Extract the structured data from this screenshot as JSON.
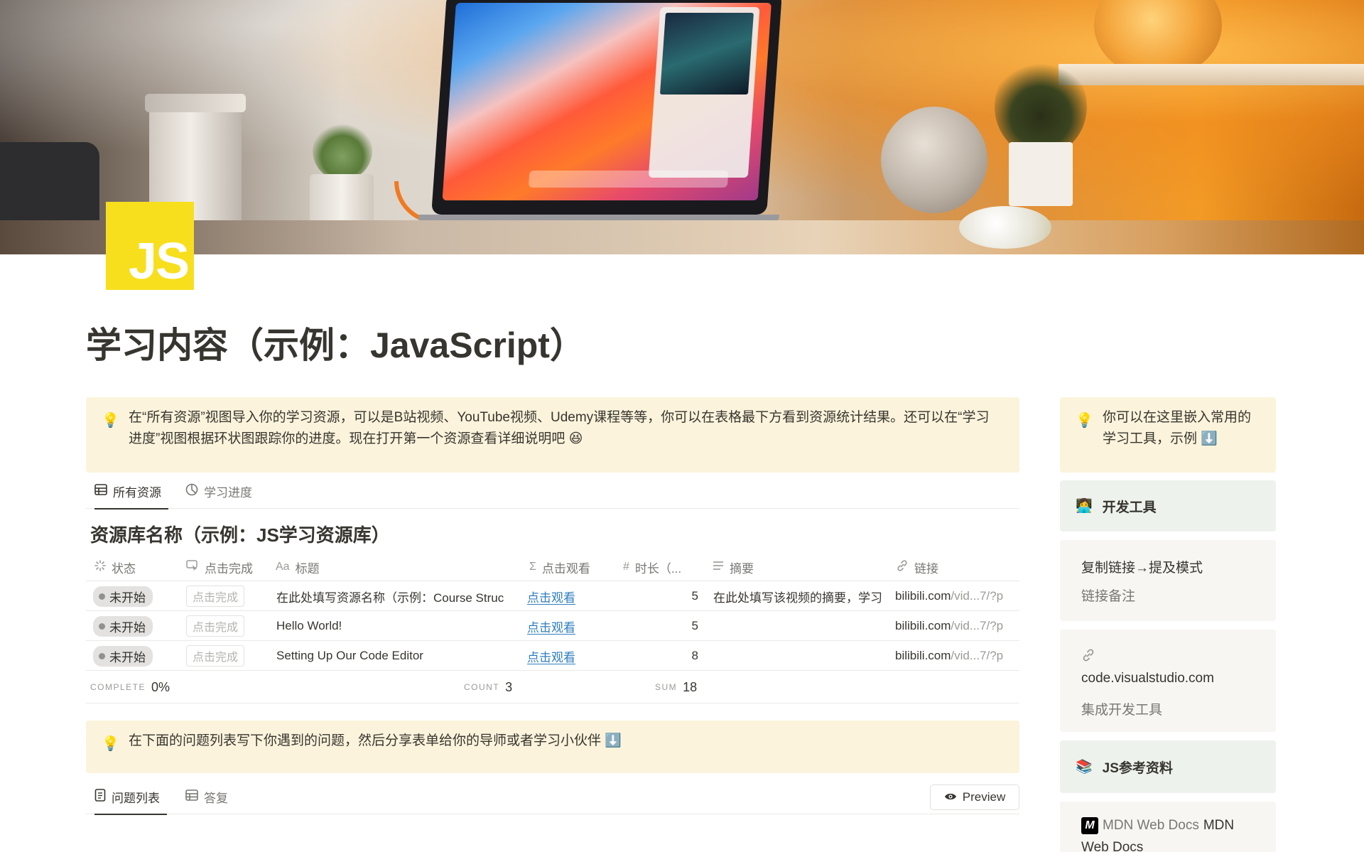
{
  "page": {
    "icon_text": "JS",
    "title": "学习内容（示例：JavaScript）"
  },
  "callouts": {
    "top_main": "在“所有资源”视图导入你的学习资源，可以是B站视频、YouTube视频、Udemy课程等等，你可以在表格最下方看到资源统计结果。还可以在“学习进度”视图根据环状图跟踪你的进度。现在打开第一个资源查看详细说明吧 😆",
    "questions": "在下面的问题列表写下你遇到的问题，然后分享表单给你的导师或者学习小伙伴 ⬇️",
    "sidebar": "你可以在这里嵌入常用的学习工具，示例 ⬇️"
  },
  "resource_tabs": [
    {
      "label": "所有资源",
      "icon": "table-icon",
      "active": true
    },
    {
      "label": "学习进度",
      "icon": "chart-icon",
      "active": false
    }
  ],
  "database": {
    "title": "资源库名称（示例：JS学习资源库）",
    "columns": [
      {
        "label": "状态",
        "icon": "loader-icon"
      },
      {
        "label": "点击完成",
        "icon": "cursor-click-icon"
      },
      {
        "label": "标题",
        "icon": "text-icon",
        "icon_text": "Aa"
      },
      {
        "label": "点击观看",
        "icon": "formula-icon",
        "icon_text": "Σ"
      },
      {
        "label": "时长（...",
        "icon": "number-icon",
        "icon_text": "#"
      },
      {
        "label": "摘要",
        "icon": "lines-icon"
      },
      {
        "label": "链接",
        "icon": "link-icon"
      }
    ],
    "rows": [
      {
        "status": "未开始",
        "complete_btn": "点击完成",
        "title": "在此处填写资源名称（示例：Course Struc",
        "watch": "点击观看",
        "duration": "5",
        "summary": "在此处填写该视频的摘要，学习",
        "link_host": "bilibili.com",
        "link_path": "/vid...7/?p"
      },
      {
        "status": "未开始",
        "complete_btn": "点击完成",
        "title": "Hello World!",
        "watch": "点击观看",
        "duration": "5",
        "summary": "",
        "link_host": "bilibili.com",
        "link_path": "/vid...7/?p"
      },
      {
        "status": "未开始",
        "complete_btn": "点击完成",
        "title": "Setting Up Our Code Editor",
        "watch": "点击观看",
        "duration": "8",
        "summary": "",
        "link_host": "bilibili.com",
        "link_path": "/vid...7/?p"
      }
    ],
    "footer": {
      "complete_label": "COMPLETE",
      "complete_value": "0%",
      "count_label": "COUNT",
      "count_value": "3",
      "sum_label": "SUM",
      "sum_value": "18"
    }
  },
  "question_tabs": [
    {
      "label": "问题列表",
      "icon": "document-icon",
      "active": true
    },
    {
      "label": "答复",
      "icon": "table-icon",
      "active": false
    }
  ],
  "preview_button": {
    "label": "Preview",
    "icon": "eye-icon"
  },
  "sidebar": {
    "dev_tools": {
      "icon": "👩‍💻",
      "label": "开发工具"
    },
    "mention_card": {
      "line1": "复制链接→提及模式",
      "line2": "链接备注"
    },
    "vscode_card": {
      "icon": "link-icon",
      "host": "code.visualstudio.com",
      "note": "集成开发工具"
    },
    "js_refs": {
      "icon": "📚",
      "label": "JS参考资料"
    },
    "mdn_card": {
      "logo": "M",
      "line1_muted": "MDN Web Docs",
      "line1_bold": "MDN",
      "line2": "Web Docs"
    }
  },
  "colors": {
    "callout_bg": "#fbf3db",
    "green_card_bg": "#edf3ec",
    "gray_card_bg": "#f7f6f3",
    "link_blue": "#2e7dbd",
    "js_yellow": "#f7df1e",
    "text": "#37352f"
  }
}
